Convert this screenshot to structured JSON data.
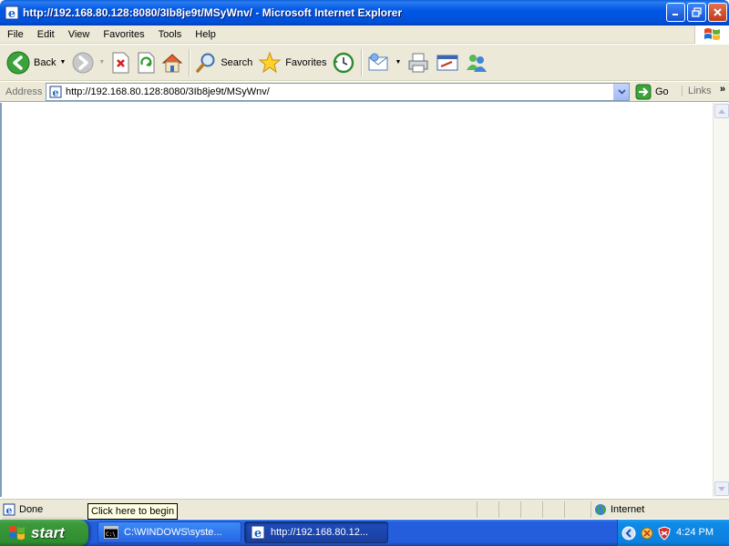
{
  "window": {
    "title": "http://192.168.80.128:8080/3Ib8je9t/MSyWnv/ - Microsoft Internet Explorer",
    "buttons": [
      "minimize-icon",
      "maximize-icon",
      "close-icon"
    ]
  },
  "menu": {
    "items": [
      "File",
      "Edit",
      "View",
      "Favorites",
      "Tools",
      "Help"
    ]
  },
  "toolbar": {
    "back_label": "Back",
    "search_label": "Search",
    "favorites_label": "Favorites"
  },
  "address": {
    "label": "Address",
    "url": "http://192.168.80.128:8080/3Ib8je9t/MSyWnv/",
    "go_label": "Go",
    "links_label": "Links",
    "more_label": "»"
  },
  "status": {
    "text": "Done",
    "zone": "Internet"
  },
  "tooltip": {
    "text": "Click here to begin"
  },
  "taskbar": {
    "start_label": "start",
    "tasks": [
      {
        "label": "C:\\WINDOWS\\syste...",
        "icon": "cmd-icon"
      },
      {
        "label": "http://192.168.80.12...",
        "icon": "ie-icon"
      }
    ],
    "clock": "4:24 PM"
  },
  "colors": {
    "titlebar": "#0058e6",
    "chrome": "#ece9d8",
    "taskbar": "#245edc",
    "start": "#3c9a3c",
    "tray": "#0f8ae6",
    "tooltip": "#ffffe1"
  }
}
